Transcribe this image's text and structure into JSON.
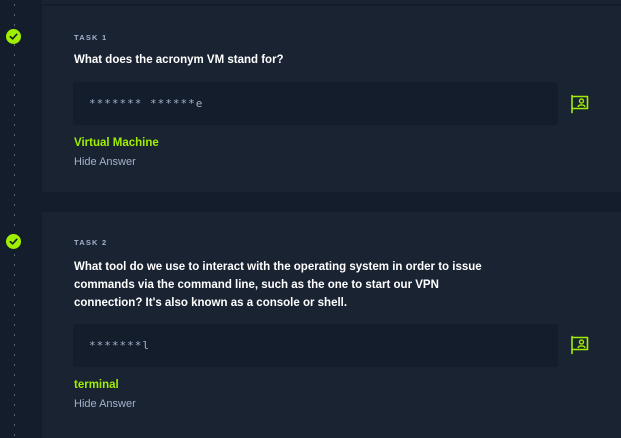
{
  "colors": {
    "background": "#141d2b",
    "card": "#1a2332",
    "accent": "#9fef00",
    "muted": "#a4b1cd",
    "text": "#ffffff"
  },
  "tasks": [
    {
      "label": "TASK 1",
      "status_icon": "check-circle-icon",
      "question": "What does the acronym VM stand for?",
      "answer_placeholder": "******* ******e",
      "answer": "Virtual Machine",
      "hide_label": "Hide Answer",
      "flag_icon": "flag-icon"
    },
    {
      "label": "TASK 2",
      "status_icon": "check-circle-icon",
      "question": "What tool do we use to interact with the operating system in order to issue commands via the command line, such as the one to start our VPN connection? It's also known as a console or shell.",
      "answer_placeholder": "*******l",
      "answer": "terminal",
      "hide_label": "Hide Answer",
      "flag_icon": "flag-icon"
    }
  ]
}
